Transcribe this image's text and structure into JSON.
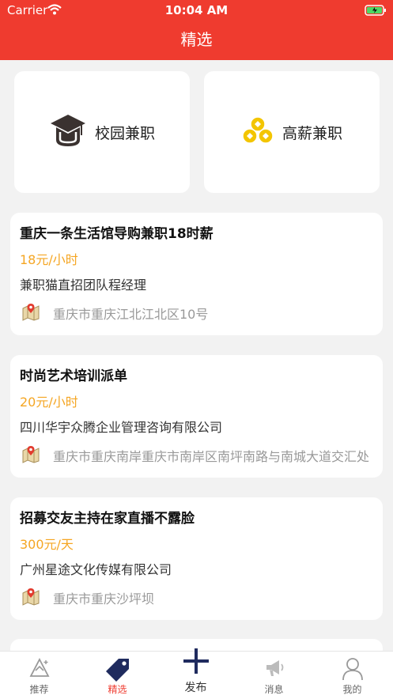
{
  "status_bar": {
    "carrier": "Carrier",
    "time": "10:04 AM"
  },
  "nav": {
    "title": "精选"
  },
  "categories": [
    {
      "label": "校园兼职",
      "icon": "graduation-cap-icon"
    },
    {
      "label": "高薪兼职",
      "icon": "gold-coins-icon"
    }
  ],
  "jobs": [
    {
      "title": "重庆一条生活馆导购兼职18时薪",
      "salary": "18元/小时",
      "company": "兼职猫直招团队程经理",
      "location": "重庆市重庆江北江北区10号"
    },
    {
      "title": "时尚艺术培训派单",
      "salary": "20元/小时",
      "company": "四川华宇众腾企业管理咨询有限公司",
      "location": "重庆市重庆南岸重庆市南岸区南坪南路与南城大道交汇处"
    },
    {
      "title": "招募交友主持在家直播不露脸",
      "salary": "300元/天",
      "company": "广州星途文化传媒有限公司",
      "location": "重庆市重庆沙坪坝"
    }
  ],
  "tabs": [
    {
      "label": "推荐",
      "icon": "recommend-icon"
    },
    {
      "label": "精选",
      "icon": "tag-icon"
    },
    {
      "label": "发布",
      "icon": "plus-icon"
    },
    {
      "label": "消息",
      "icon": "megaphone-icon"
    },
    {
      "label": "我的",
      "icon": "user-icon"
    }
  ],
  "colors": {
    "brand_red": "#ef3b2f",
    "salary_orange": "#f5a623",
    "publish_navy": "#1f2b5e"
  }
}
